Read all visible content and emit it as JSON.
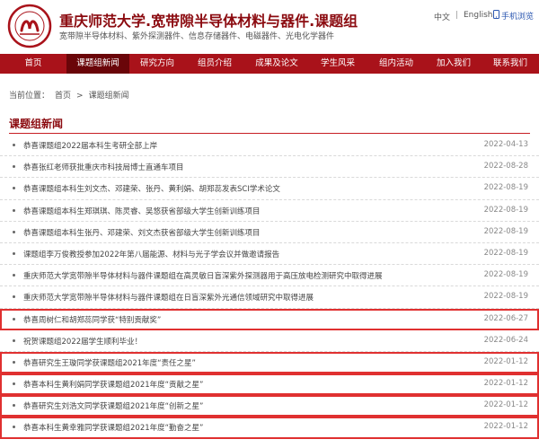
{
  "header": {
    "title": "重庆师范大学.宽带隙半导体材料与器件.课题组",
    "subtitle": "宽带隙半导体材料、紫外探测器件、信息存储器件、电磁器件、光电化学器件",
    "lang_zh": "中文",
    "lang_sep": "|",
    "lang_en": "English",
    "mobile": "手机浏览"
  },
  "nav": {
    "items": [
      {
        "label": "首页"
      },
      {
        "label": "课题组新闻"
      },
      {
        "label": "研究方向"
      },
      {
        "label": "组员介绍"
      },
      {
        "label": "成果及论文"
      },
      {
        "label": "学生风采"
      },
      {
        "label": "组内活动"
      },
      {
        "label": "加入我们"
      },
      {
        "label": "联系我们"
      }
    ]
  },
  "breadcrumb": {
    "prefix": "当前位置：",
    "home": "首页",
    "sep": ">",
    "current": "课题组新闻"
  },
  "section": {
    "title": "课题组新闻"
  },
  "news": [
    {
      "title": "恭喜课题组2022届本科生考研全部上岸",
      "date": "2022-04-13"
    },
    {
      "title": "恭喜张红老师获批重庆市科技局博士直通车项目",
      "date": "2022-08-28"
    },
    {
      "title": "恭喜课题组本科生刘文杰、邓建荣、张丹、黄利娟、胡郑蕊发表SCI学术论文",
      "date": "2022-08-19"
    },
    {
      "title": "恭喜课题组本科生郑琪琪、陈灵睿、吴悠获省部级大学生创新训练项目",
      "date": "2022-08-19"
    },
    {
      "title": "恭喜课题组本科生张丹、邓建荣、刘文杰获省部级大学生创新训练项目",
      "date": "2022-08-19"
    },
    {
      "title": "课题组李万俊教授参加2022年第八届能源、材料与光子学会议并做邀请报告",
      "date": "2022-08-19"
    },
    {
      "title": "重庆师范大学宽带隙半导体材料与器件课题组在高灵敏日盲深紫外探测器用于高压放电检测研究中取得进展",
      "date": "2022-08-19"
    },
    {
      "title": "重庆师范大学宽带隙半导体材料与器件课题组在日盲深紫外光通信领域研究中取得进展",
      "date": "2022-08-19"
    },
    {
      "title": "恭喜周树仁和胡郑蕊同学获“特别贡献奖”",
      "date": "2022-06-27"
    },
    {
      "title": "祝贺课题组2022届学生顺利毕业！",
      "date": "2022-06-24"
    },
    {
      "title": "恭喜研究生王璇同学获课题组2021年度“责任之星”",
      "date": "2022-01-12"
    },
    {
      "title": "恭喜本科生黄利娟同学获课题组2021年度“贡献之星”",
      "date": "2022-01-12"
    },
    {
      "title": "恭喜研究生刘浩文同学获课题组2021年度“创新之星”",
      "date": "2022-01-12"
    },
    {
      "title": "恭喜本科生黄幸雅同学获课题组2021年度“勤奋之星”",
      "date": "2022-01-12"
    }
  ]
}
